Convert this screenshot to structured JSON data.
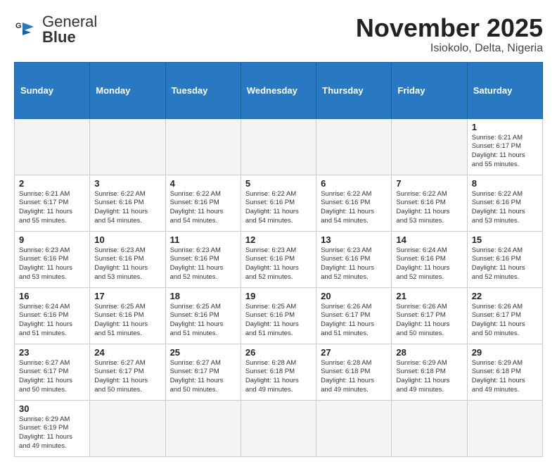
{
  "logo": {
    "text_general": "General",
    "text_blue": "Blue"
  },
  "header": {
    "month_title": "November 2025",
    "location": "Isiokolo, Delta, Nigeria"
  },
  "weekdays": [
    "Sunday",
    "Monday",
    "Tuesday",
    "Wednesday",
    "Thursday",
    "Friday",
    "Saturday"
  ],
  "weeks": [
    [
      {
        "day": "",
        "info": ""
      },
      {
        "day": "",
        "info": ""
      },
      {
        "day": "",
        "info": ""
      },
      {
        "day": "",
        "info": ""
      },
      {
        "day": "",
        "info": ""
      },
      {
        "day": "",
        "info": ""
      },
      {
        "day": "1",
        "info": "Sunrise: 6:21 AM\nSunset: 6:17 PM\nDaylight: 11 hours\nand 55 minutes."
      }
    ],
    [
      {
        "day": "2",
        "info": "Sunrise: 6:21 AM\nSunset: 6:17 PM\nDaylight: 11 hours\nand 55 minutes."
      },
      {
        "day": "3",
        "info": "Sunrise: 6:22 AM\nSunset: 6:16 PM\nDaylight: 11 hours\nand 54 minutes."
      },
      {
        "day": "4",
        "info": "Sunrise: 6:22 AM\nSunset: 6:16 PM\nDaylight: 11 hours\nand 54 minutes."
      },
      {
        "day": "5",
        "info": "Sunrise: 6:22 AM\nSunset: 6:16 PM\nDaylight: 11 hours\nand 54 minutes."
      },
      {
        "day": "6",
        "info": "Sunrise: 6:22 AM\nSunset: 6:16 PM\nDaylight: 11 hours\nand 54 minutes."
      },
      {
        "day": "7",
        "info": "Sunrise: 6:22 AM\nSunset: 6:16 PM\nDaylight: 11 hours\nand 53 minutes."
      },
      {
        "day": "8",
        "info": "Sunrise: 6:22 AM\nSunset: 6:16 PM\nDaylight: 11 hours\nand 53 minutes."
      }
    ],
    [
      {
        "day": "9",
        "info": "Sunrise: 6:23 AM\nSunset: 6:16 PM\nDaylight: 11 hours\nand 53 minutes."
      },
      {
        "day": "10",
        "info": "Sunrise: 6:23 AM\nSunset: 6:16 PM\nDaylight: 11 hours\nand 53 minutes."
      },
      {
        "day": "11",
        "info": "Sunrise: 6:23 AM\nSunset: 6:16 PM\nDaylight: 11 hours\nand 52 minutes."
      },
      {
        "day": "12",
        "info": "Sunrise: 6:23 AM\nSunset: 6:16 PM\nDaylight: 11 hours\nand 52 minutes."
      },
      {
        "day": "13",
        "info": "Sunrise: 6:23 AM\nSunset: 6:16 PM\nDaylight: 11 hours\nand 52 minutes."
      },
      {
        "day": "14",
        "info": "Sunrise: 6:24 AM\nSunset: 6:16 PM\nDaylight: 11 hours\nand 52 minutes."
      },
      {
        "day": "15",
        "info": "Sunrise: 6:24 AM\nSunset: 6:16 PM\nDaylight: 11 hours\nand 52 minutes."
      }
    ],
    [
      {
        "day": "16",
        "info": "Sunrise: 6:24 AM\nSunset: 6:16 PM\nDaylight: 11 hours\nand 51 minutes."
      },
      {
        "day": "17",
        "info": "Sunrise: 6:25 AM\nSunset: 6:16 PM\nDaylight: 11 hours\nand 51 minutes."
      },
      {
        "day": "18",
        "info": "Sunrise: 6:25 AM\nSunset: 6:16 PM\nDaylight: 11 hours\nand 51 minutes."
      },
      {
        "day": "19",
        "info": "Sunrise: 6:25 AM\nSunset: 6:16 PM\nDaylight: 11 hours\nand 51 minutes."
      },
      {
        "day": "20",
        "info": "Sunrise: 6:26 AM\nSunset: 6:17 PM\nDaylight: 11 hours\nand 51 minutes."
      },
      {
        "day": "21",
        "info": "Sunrise: 6:26 AM\nSunset: 6:17 PM\nDaylight: 11 hours\nand 50 minutes."
      },
      {
        "day": "22",
        "info": "Sunrise: 6:26 AM\nSunset: 6:17 PM\nDaylight: 11 hours\nand 50 minutes."
      }
    ],
    [
      {
        "day": "23",
        "info": "Sunrise: 6:27 AM\nSunset: 6:17 PM\nDaylight: 11 hours\nand 50 minutes."
      },
      {
        "day": "24",
        "info": "Sunrise: 6:27 AM\nSunset: 6:17 PM\nDaylight: 11 hours\nand 50 minutes."
      },
      {
        "day": "25",
        "info": "Sunrise: 6:27 AM\nSunset: 6:17 PM\nDaylight: 11 hours\nand 50 minutes."
      },
      {
        "day": "26",
        "info": "Sunrise: 6:28 AM\nSunset: 6:18 PM\nDaylight: 11 hours\nand 49 minutes."
      },
      {
        "day": "27",
        "info": "Sunrise: 6:28 AM\nSunset: 6:18 PM\nDaylight: 11 hours\nand 49 minutes."
      },
      {
        "day": "28",
        "info": "Sunrise: 6:29 AM\nSunset: 6:18 PM\nDaylight: 11 hours\nand 49 minutes."
      },
      {
        "day": "29",
        "info": "Sunrise: 6:29 AM\nSunset: 6:18 PM\nDaylight: 11 hours\nand 49 minutes."
      }
    ],
    [
      {
        "day": "30",
        "info": "Sunrise: 6:29 AM\nSunset: 6:19 PM\nDaylight: 11 hours\nand 49 minutes."
      },
      {
        "day": "",
        "info": ""
      },
      {
        "day": "",
        "info": ""
      },
      {
        "day": "",
        "info": ""
      },
      {
        "day": "",
        "info": ""
      },
      {
        "day": "",
        "info": ""
      },
      {
        "day": "",
        "info": ""
      }
    ]
  ]
}
